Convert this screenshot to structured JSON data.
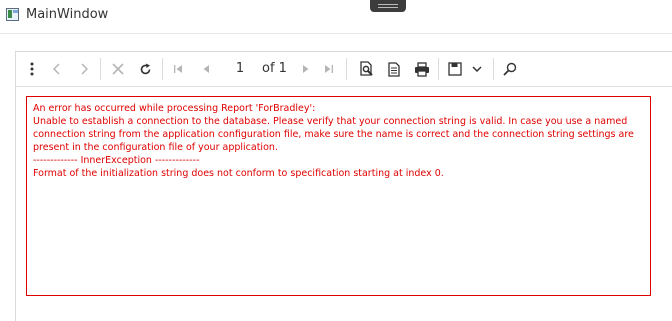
{
  "window": {
    "title": "MainWindow"
  },
  "toolbar": {
    "current_page": "1",
    "of_label": "of",
    "total_pages": "1",
    "icons": [
      "more-icon",
      "back-icon",
      "forward-icon",
      "stop-icon",
      "refresh-icon",
      "first-page-icon",
      "previous-page-icon",
      "next-page-icon",
      "last-page-icon",
      "print-preview-icon",
      "page-setup-icon",
      "print-icon",
      "save-icon",
      "save-dropdown-icon",
      "find-icon"
    ]
  },
  "report": {
    "error_lines": [
      "An error has occurred while processing Report 'ForBradley':",
      "Unable to establish a connection to the database. Please verify that your connection string is valid. In case you use a named connection string from the application configuration file, make sure the name is correct and the connection string settings are present in the configuration file of your application.",
      "------------- InnerException -------------",
      "Format of the initialization string does not conform to specification starting at index 0."
    ]
  },
  "colors": {
    "error": "#e00000",
    "toolbar_icon": "#333333",
    "toolbar_icon_disabled": "#b5b5b5"
  }
}
